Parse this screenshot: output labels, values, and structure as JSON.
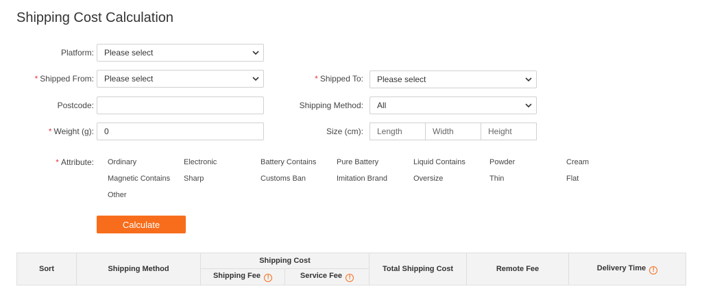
{
  "page_title": "Shipping Cost Calculation",
  "form": {
    "platform": {
      "label": "Platform:",
      "value": "Please select"
    },
    "shipped_from": {
      "label": "Shipped From:",
      "value": "Please select",
      "required": "*"
    },
    "shipped_to": {
      "label": "Shipped To:",
      "value": "Please select",
      "required": "*"
    },
    "postcode": {
      "label": "Postcode:",
      "value": ""
    },
    "shipping_method": {
      "label": "Shipping Method:",
      "value": "All"
    },
    "weight": {
      "label": "Weight (g):",
      "value": "0",
      "required": "*"
    },
    "size": {
      "label": "Size (cm):",
      "length_placeholder": "Length",
      "width_placeholder": "Width",
      "height_placeholder": "Height"
    },
    "attribute": {
      "label": "Attribute:",
      "required": "*",
      "options": [
        "Ordinary",
        "Electronic",
        "Battery Contains",
        "Pure Battery",
        "Liquid Contains",
        "Powder",
        "Cream",
        "Magnetic Contains",
        "Sharp",
        "Customs Ban",
        "Imitation Brand",
        "Oversize",
        "Thin",
        "Flat",
        "Other"
      ]
    },
    "calculate_label": "Calculate"
  },
  "results_table": {
    "headers": {
      "sort": "Sort",
      "shipping_method": "Shipping Method",
      "shipping_cost": "Shipping Cost",
      "shipping_fee": "Shipping Fee",
      "service_fee": "Service Fee",
      "total_shipping_cost": "Total Shipping Cost",
      "remote_fee": "Remote Fee",
      "delivery_time": "Delivery Time"
    },
    "info_icon": "exclamation-circle-icon"
  },
  "colors": {
    "accent": "#f76d1c",
    "required": "#e4393c",
    "table_header_bg": "#f3f3f3"
  }
}
